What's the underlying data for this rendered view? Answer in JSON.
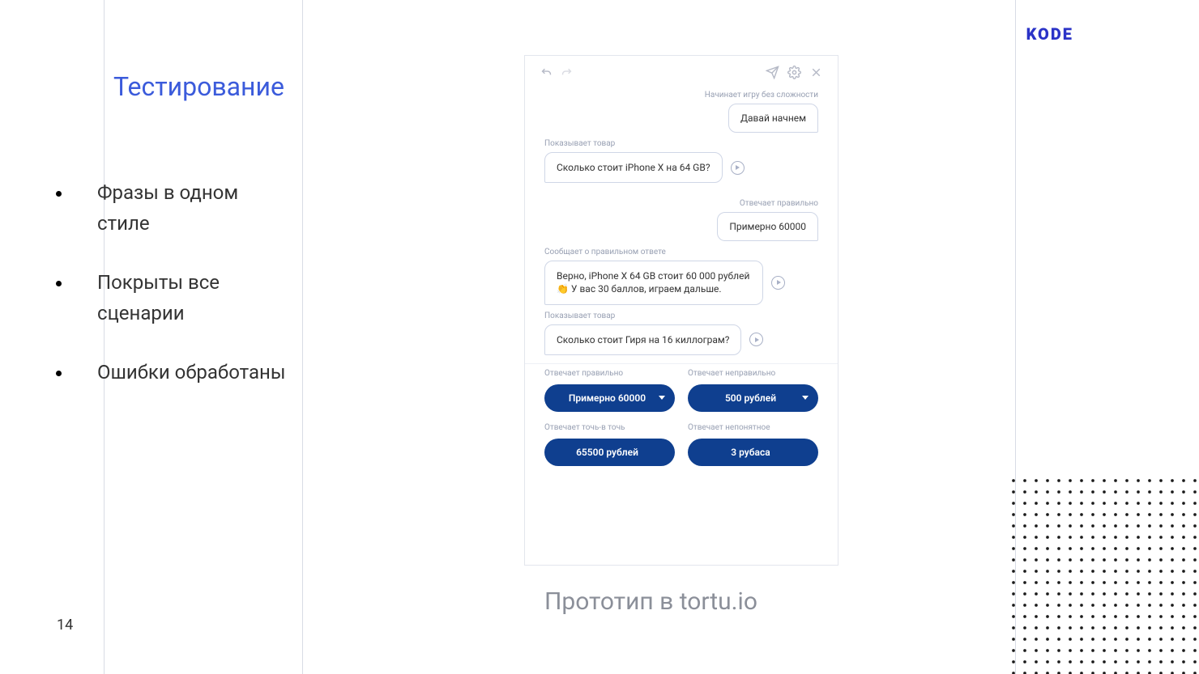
{
  "page_number": "14",
  "brand": "KODE",
  "title": "Тестирование",
  "bullets": [
    "Фразы в одном стиле",
    "Покрыты все сценарии",
    "Ошибки обработаны"
  ],
  "caption": "Прототип в tortu.io",
  "proto": {
    "meta1": "Начинает игру без сложности",
    "bubble_r1": "Давай начнем",
    "meta2": "Показывает товар",
    "bubble_l1": "Сколько стоит iPhone X на 64 GB?",
    "meta3": "Отвечает правильно",
    "bubble_r2": "Примерно 60000",
    "meta4": "Сообщает о правильном ответе",
    "bubble_l2": "Верно, iPhone X 64 GB стоит 60 000 рублей 👏 У вас 30 баллов, играем дальше.",
    "meta5": "Показывает товар",
    "bubble_l3": "Сколько стоит Гиря на 16 киллограм?",
    "options": [
      {
        "label": "Отвечает правильно",
        "pill": "Примерно 60000",
        "caret": true
      },
      {
        "label": "Отвечает неправильно",
        "pill": "500 рублей",
        "caret": true
      },
      {
        "label": "Отвечает точь-в точь",
        "pill": "65500 рублей",
        "caret": false
      },
      {
        "label": "Отвечает непонятное",
        "pill": "3 рубаса",
        "caret": false
      }
    ]
  }
}
